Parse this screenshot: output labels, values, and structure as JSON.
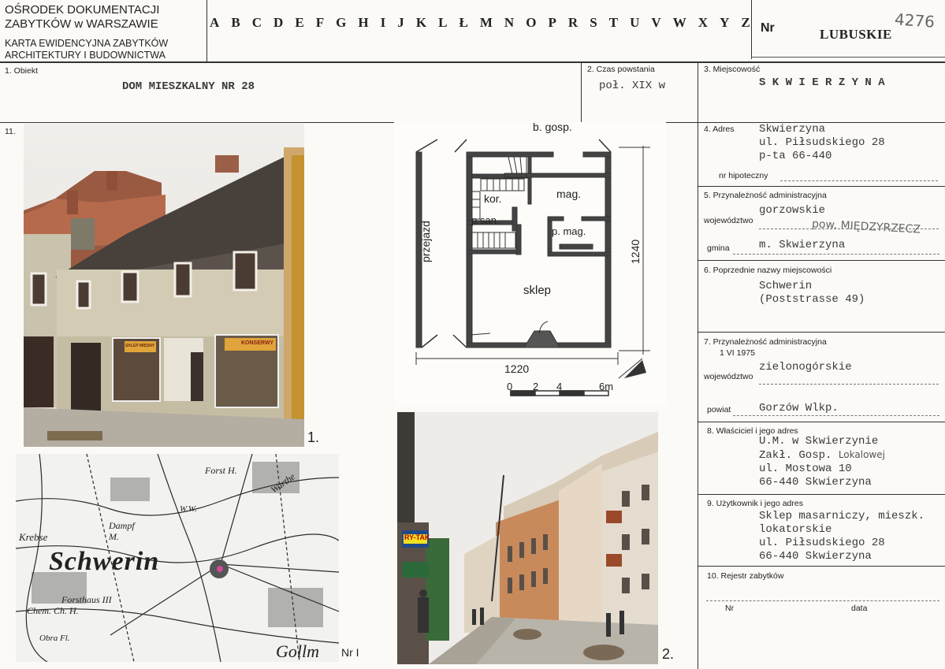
{
  "header": {
    "org_line1": "OŚRODEK DOKUMENTACJI",
    "org_line2": "ZABYTKÓW w WARSZAWIE",
    "card_line1": "KARTA EWIDENCYJNA ZABYTKÓW",
    "card_line2": "ARCHITEKTURY I BUDOWNICTWA",
    "letters": [
      "A",
      "B",
      "C",
      "D",
      "E",
      "F",
      "G",
      "H",
      "I",
      "J",
      "K",
      "L",
      "Ł",
      "M",
      "N",
      "O",
      "P",
      "R",
      "S",
      "T",
      "U",
      "V",
      "W",
      "X",
      "Y",
      "Z"
    ],
    "nr_label": "Nr",
    "region": "LUBUSKIE",
    "card_number": "4276"
  },
  "fields": {
    "obiekt_label": "1. Obiekt",
    "obiekt_value": "DOM MIESZKALNY NR 28",
    "czas_label": "2. Czas powstania",
    "czas_value": "poł. XIX w",
    "miejscowosc_label": "3. Miejscowość",
    "miejscowosc_value": "S K W I E R Z Y N A",
    "section11_label": "11.",
    "adres_label": "4. Adres",
    "adres_lines": [
      "Skwierzyna",
      "ul. Piłsudskiego 28",
      "p-ta 66-440"
    ],
    "hipoteczny_label": "nr hipoteczny",
    "przynaleznosc_label": "5. Przynależność administracyjna",
    "wojewodztwo_label": "województwo",
    "wojewodztwo_value": "gorzowskie",
    "pow_handwritten": "pow. MIĘDZYRZECZ",
    "gmina_label": "gmina",
    "gmina_value": "m. Skwierzyna",
    "poprzednie_label": "6. Poprzednie nazwy miejscowości",
    "poprzednie_lines": [
      "Schwerin",
      "(Poststrasse 49)"
    ],
    "przynaleznosc1975_label": "7. Przynależność administracyjna",
    "date_1975": "1 VI 1975",
    "wojewodztwo2_label": "województwo",
    "wojewodztwo2_value": "zielonogórskie",
    "powiat_label": "powiat",
    "powiat_value": "Gorzów Wlkp.",
    "wlasciciel_label": "8. Właściciel i jego adres",
    "wlasciciel_lines": [
      "U.M. w Skwierzynie",
      "Zakł. Gosp.",
      "ul. Mostowa 10",
      "66-440 Skwierzyna"
    ],
    "wlasciciel_hand": "Lokalowej",
    "uzytkownik_label": "9. Użytkownik i jego adres",
    "uzytkownik_lines": [
      "Sklep masarniczy, mieszk.",
      "lokatorskie",
      "ul. Piłsudskiego 28",
      "66-440 Skwierzyna"
    ],
    "rejestr_label": "10. Rejestr zabytków",
    "nr_label": "Nr",
    "data_label": "data"
  },
  "plan": {
    "b_gosp": "b. gosp.",
    "kor": "kor.",
    "mag": "mag.",
    "p_san": "p.san.",
    "p_mag": "p. mag.",
    "sklep": "sklep",
    "przejazd": "przejazd",
    "dim_width": "1220",
    "dim_depth": "1240",
    "scale_0": "0",
    "scale_2": "2",
    "scale_4": "4",
    "scale_6m": "6m"
  },
  "photos": {
    "photo1_num": "1.",
    "photo2_num": "2.",
    "map_num": "Nr I",
    "shop_sign1": "SKLEP MIĘSNY",
    "shop_sign2": "KONSERWY",
    "street_sign": "RY-TAK",
    "map_city": "Schwerin",
    "map_labels": [
      "Forst H.",
      "Warthe",
      "W.W.",
      "Dampf M.",
      "Krebse",
      "Forsthaus III",
      "Chem. Ch. H.",
      "Obra Fl.",
      "Gollm"
    ]
  }
}
